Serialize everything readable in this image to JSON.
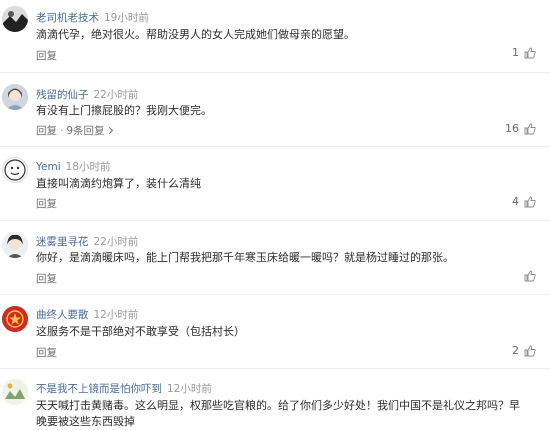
{
  "comments": [
    {
      "username": "老司机老技术",
      "time": "19小时前",
      "text": "滴滴代孕，绝对很火。帮助没男人的女人完成她们做母亲的愿望。",
      "reply_label": "回复",
      "likes": "1",
      "avatar": "black-white-avatar"
    },
    {
      "username": "残留的仙子",
      "time": "22小时前",
      "text": "有没有上门擦屁股的？我刚大便完。",
      "reply_label": "回复",
      "replies_label": "9条回复",
      "likes": "16",
      "avatar": "girl-avatar"
    },
    {
      "username": "Yemi",
      "time": "18小时前",
      "text": "直接叫滴滴约炮算了，装什么清纯",
      "reply_label": "回复",
      "likes": "4",
      "avatar": "cartoon-face-avatar"
    },
    {
      "username": "迷雾里寻花",
      "time": "22小时前",
      "text": "你好，是滴滴暖床吗，能上门帮我把那千年寒玉床给暖一暖吗？就是杨过睡过的那张。",
      "reply_label": "回复",
      "likes": "",
      "avatar": "girl-avatar-2"
    },
    {
      "username": "曲终人要散",
      "time": "12小时前",
      "text": "这服务不是干部绝对不敢享受（包括村长）",
      "reply_label": "回复",
      "likes": "2",
      "avatar": "red-emblem-avatar"
    },
    {
      "username": "不是我不上镜而是怕你吓到",
      "time": "12小时前",
      "text": "天天喊打击黄赌毒。这么明显，权那些吃官粮的。给了你们多少好处！我们中国不是礼仪之邦吗？早",
      "text2": "晚要被这些东西毁掉",
      "reply_label": "",
      "likes": "",
      "avatar": "pattern-avatar"
    }
  ]
}
